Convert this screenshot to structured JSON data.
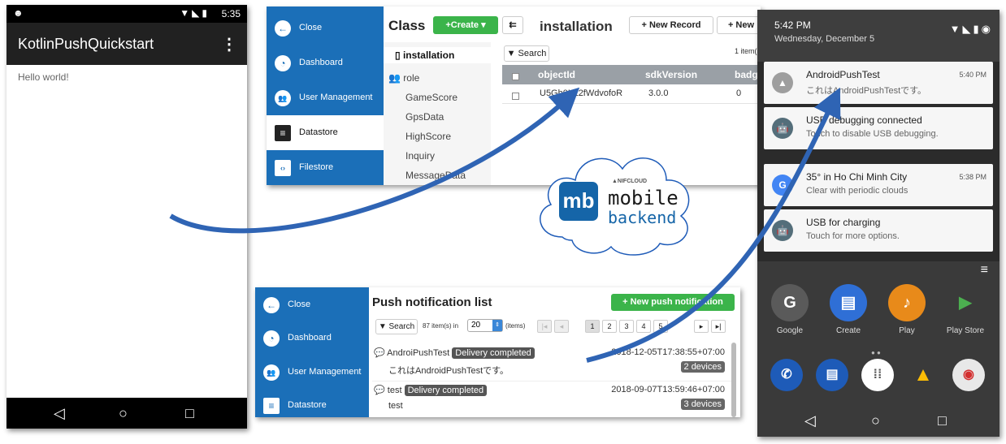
{
  "phone": {
    "status_time": "5:35",
    "app_title": "KotlinPushQuickstart",
    "menu_icon": "⋮",
    "body_text": "Hello world!",
    "nav": {
      "back": "◁",
      "home": "○",
      "recents": "□"
    }
  },
  "datastore": {
    "sidebar": [
      {
        "label": "Close",
        "icon": "arrow-left-icon",
        "glyph": "←"
      },
      {
        "label": "Dashboard",
        "icon": "gauge-icon",
        "glyph": "◔"
      },
      {
        "label": "User Management",
        "icon": "users-icon",
        "glyph": "👥"
      },
      {
        "label": "Datastore",
        "icon": "database-icon",
        "glyph": "≡"
      },
      {
        "label": "Filestore",
        "icon": "file-icon",
        "glyph": "‹›"
      }
    ],
    "class_header": "Class",
    "create_label": "+Create ▾",
    "classes": [
      "installation",
      "role",
      "GameScore",
      "GpsData",
      "HighScore",
      "Inquiry",
      "MessageData"
    ],
    "table_name": "installation",
    "new_record_label": "+ New Record",
    "new_label": "+ New",
    "search_label": "Search",
    "items_text": "1 item(s",
    "columns": [
      "objectId",
      "sdkVersion",
      "badg"
    ],
    "row": {
      "objectId": "U5Gh0LZ2fWdvofoR",
      "sdkVersion": "3.0.0",
      "badge": "0"
    }
  },
  "cloud": {
    "logo_mark": "mb",
    "brand_small": "▲NIFCLOUD",
    "brand_line1": "mobile",
    "brand_line2": "backend"
  },
  "push": {
    "sidebar": [
      {
        "label": "Close",
        "glyph": "←"
      },
      {
        "label": "Dashboard",
        "glyph": "◔"
      },
      {
        "label": "User Management",
        "glyph": "👥"
      },
      {
        "label": "Datastore",
        "glyph": "≡"
      }
    ],
    "title": "Push notification list",
    "new_push_label": "+ New push notification",
    "search_label": "Search",
    "count_prefix": "87 item(s) in",
    "per_page": "20",
    "count_suffix": "(items)",
    "pages": [
      "1",
      "2",
      "3",
      "4",
      "5"
    ],
    "rows": [
      {
        "title": "AndroiPushTest",
        "status": "Delivery completed",
        "body": "これはAndroidPushTestです。",
        "date": "2018-12-05T17:38:55+07:00",
        "devices": "2 devices"
      },
      {
        "title": "test",
        "status": "Delivery completed",
        "body": "test",
        "date": "2018-09-07T13:59:46+07:00",
        "devices": "3 devices"
      }
    ]
  },
  "shade": {
    "time": "5:42 PM",
    "date": "Wednesday, December 5",
    "notifications": [
      {
        "title": "AndroidPushTest",
        "body": "これはAndroidPushTestです。",
        "time": "5:40 PM",
        "icon_color": "#9e9e9e",
        "glyph": "▲"
      },
      {
        "title": "USB debugging connected",
        "body": "Touch to disable USB debugging.",
        "time": "",
        "icon_color": "#546e7a",
        "glyph": "🤖"
      },
      {
        "title": "35° in Ho Chi Minh City",
        "body": "Clear with periodic clouds",
        "time": "5:38 PM",
        "icon_color": "#4285f4",
        "glyph": "G"
      },
      {
        "title": "USB for charging",
        "body": "Touch for more options.",
        "time": "",
        "icon_color": "#546e7a",
        "glyph": "🤖"
      }
    ],
    "apps": [
      {
        "label": "Google",
        "glyph": "G"
      },
      {
        "label": "Create",
        "glyph": "▤"
      },
      {
        "label": "Play",
        "glyph": "♪"
      },
      {
        "label": "Play Store",
        "glyph": "▶"
      }
    ],
    "dock_colors": [
      "#1e5bb8",
      "#1e5bb8",
      "#ffffff",
      "#fbbc05",
      "#e8e8e8"
    ],
    "nav": {
      "back": "◁",
      "home": "○",
      "recents": "□"
    }
  },
  "colors": {
    "sidebar_blue": "#1b6fb8",
    "create_green": "#3bb44a",
    "arrow_blue": "#2f64b4"
  }
}
